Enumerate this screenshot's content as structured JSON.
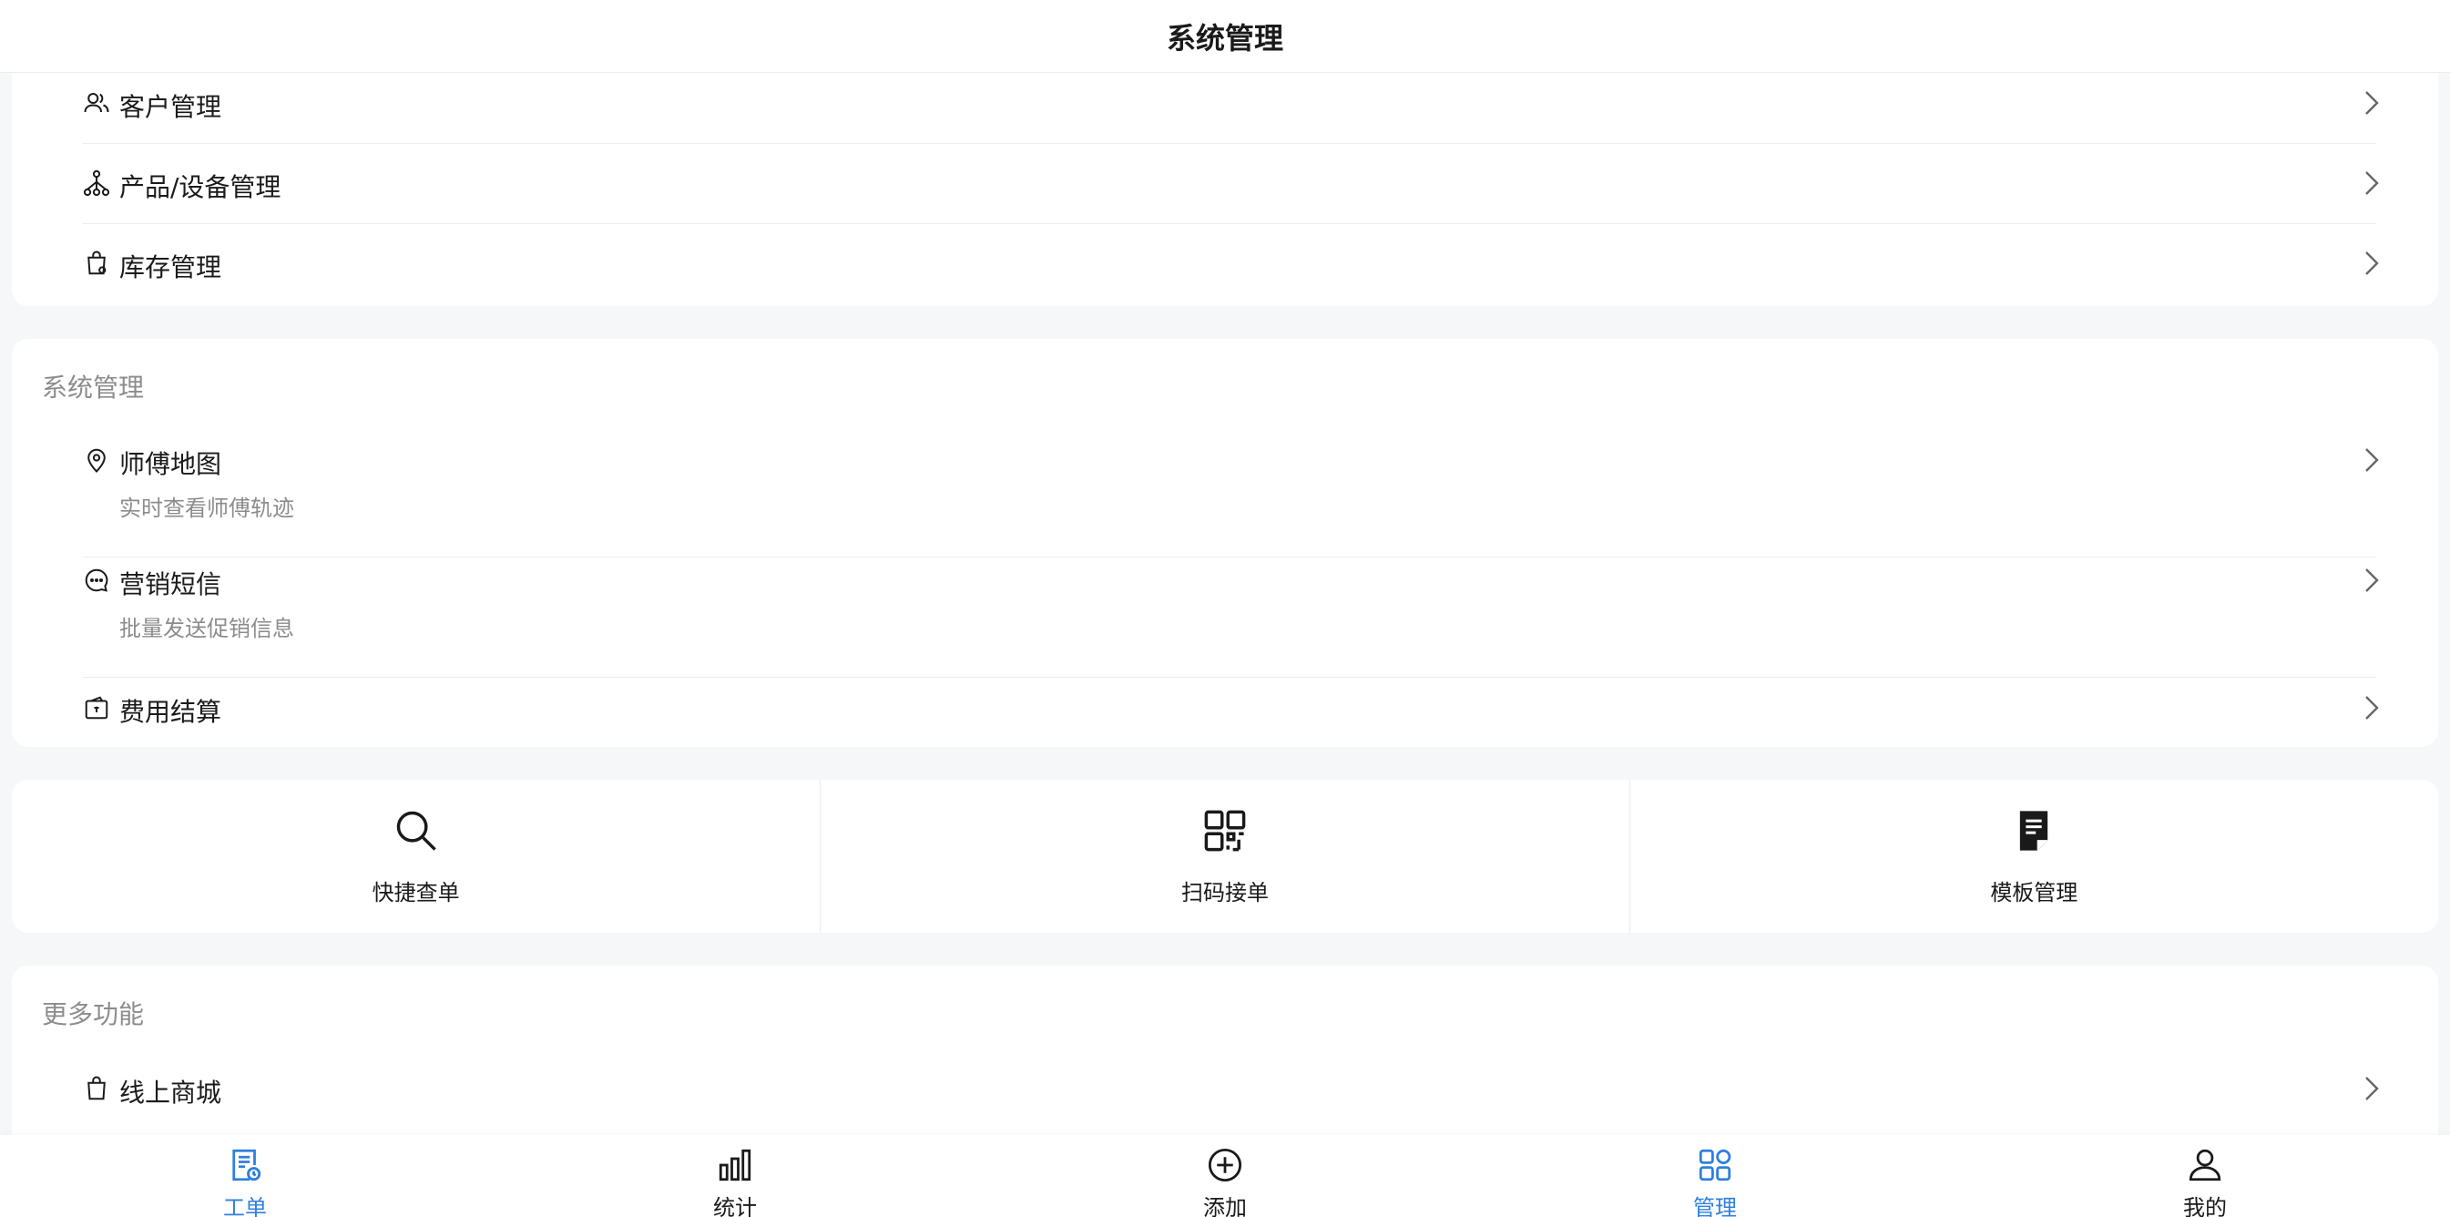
{
  "header": {
    "title": "系统管理"
  },
  "group1": {
    "items": [
      {
        "label": "客户管理"
      },
      {
        "label": "产品/设备管理"
      },
      {
        "label": "库存管理"
      }
    ]
  },
  "group2": {
    "title": "系统管理",
    "items": [
      {
        "label": "师傅地图",
        "desc": "实时查看师傅轨迹"
      },
      {
        "label": "营销短信",
        "desc": "批量发送促销信息"
      },
      {
        "label": "费用结算"
      }
    ]
  },
  "quick": {
    "items": [
      {
        "label": "快捷查单",
        "icon": "search-icon"
      },
      {
        "label": "扫码接单",
        "icon": "qrcode-icon"
      },
      {
        "label": "模板管理",
        "icon": "document-icon"
      }
    ]
  },
  "more": {
    "title": "更多功能",
    "items": [
      {
        "label": "线上商城"
      }
    ]
  },
  "tabbar": {
    "active_color": "#2f7fe0",
    "items": [
      {
        "label": "工单"
      },
      {
        "label": "统计"
      },
      {
        "label": "添加"
      },
      {
        "label": "管理"
      },
      {
        "label": "我的"
      }
    ]
  }
}
